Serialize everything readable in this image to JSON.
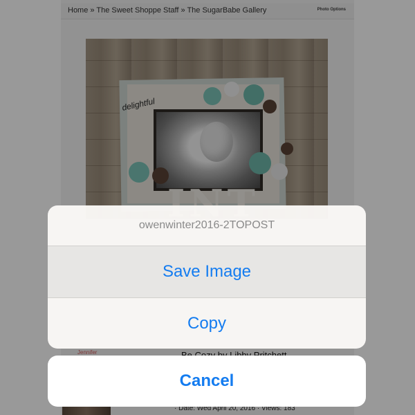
{
  "breadcrumb": "Home » The Sweet Shoppe Staff » The SugarBabe Gallery",
  "photo_options_label": "Photo Options",
  "gallery": {
    "uploader": "Jennifer",
    "caption": "Be Cozy by Libby Pritchett",
    "meta": "· Date: Wed April 20, 2016 · Views: 183"
  },
  "action_sheet": {
    "title": "owenwinter2016-2TOPOST",
    "save_image_label": "Save Image",
    "copy_label": "Copy",
    "cancel_label": "Cancel"
  },
  "colors": {
    "ios_blue": "#147cf0",
    "sheet_background": "#faf8f6",
    "overlay": "rgba(0,0,0,0.40)"
  }
}
